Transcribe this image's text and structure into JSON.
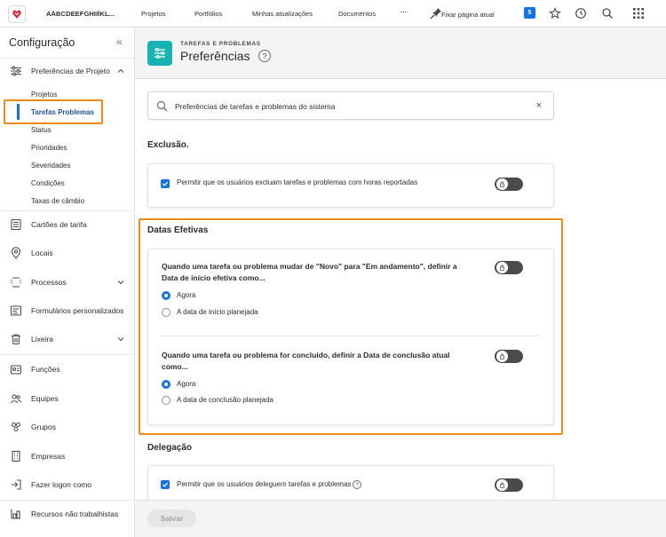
{
  "topbar": {
    "org_name": "AÄBCDEEFGHIIÏKL...",
    "nav": [
      "Projetos",
      "Portfólios",
      "Minhas atualizações",
      "Documentos",
      "···"
    ],
    "pin_label": "Fixar página atual",
    "badge": "5",
    "icons": [
      "star-icon",
      "history-icon",
      "search-icon",
      "apps-grid-icon"
    ]
  },
  "sidebar": {
    "title": "Configuração",
    "collapse": "«",
    "sections": [
      {
        "label": "Preferências de Projeto",
        "icon": "sliders-icon",
        "expanded": true
      },
      {
        "label": "Cartões de tarifa",
        "icon": "list-icon"
      },
      {
        "label": "Locais",
        "icon": "location-icon"
      },
      {
        "label": "Processos",
        "icon": "process-icon",
        "chevron": true
      },
      {
        "label": "Formulários personalizados",
        "icon": "form-icon"
      },
      {
        "label": "Lixeira",
        "icon": "trash-icon",
        "chevron": true
      },
      {
        "label": "Funções",
        "icon": "roles-icon"
      },
      {
        "label": "Equipes",
        "icon": "team-icon"
      },
      {
        "label": "Grupos",
        "icon": "groups-icon"
      },
      {
        "label": "Empresas",
        "icon": "building-icon"
      },
      {
        "label": "Fazer logon como",
        "icon": "login-icon"
      },
      {
        "label": "Recursos não trabalhistas",
        "icon": "resources-icon"
      }
    ],
    "sub_items": [
      "Projetos",
      "Tarefas Problemas",
      "Status",
      "Prioridades",
      "Severidades",
      "Condições",
      "Taxas de câmbio"
    ]
  },
  "header": {
    "eyebrow": "TAREFAS E PROBLEMAS",
    "title": "Preferências",
    "help": "?"
  },
  "search": {
    "value": "Preferências de tarefas e problemas do sistema",
    "clear": "×"
  },
  "sections": {
    "exclusao": {
      "heading": "Exclusão.",
      "checkbox_label": "Permitir que os usuários excluam tarefas e problemas com horas reportadas",
      "checked": true
    },
    "datas": {
      "heading": "Datas Efetivas",
      "q1": {
        "line1": "Quando uma tarefa ou problema mudar de \"Novo\" para \"Em andamento\", definir a",
        "line2": "Data de início efetiva como...",
        "options": [
          "Agora",
          "A data de início planejada"
        ],
        "selected": 0
      },
      "q2": {
        "line1": "Quando uma tarefa ou problema for concluído, definir a Data de conclusão atual",
        "line2": "como...",
        "options": [
          "Agora",
          "A data de conclusão planejada"
        ],
        "selected": 0
      }
    },
    "delegacao": {
      "heading": "Delegação",
      "checkbox_label": "Permitir que os usuários deleguem tarefas e problemas",
      "checked": true,
      "info": "?"
    }
  },
  "footer": {
    "save_label": "Salvar"
  },
  "colors": {
    "accent": "#1473e6",
    "highlight": "#f08a14",
    "header_icon": "#17b2b2",
    "logo": "#e0283a"
  }
}
